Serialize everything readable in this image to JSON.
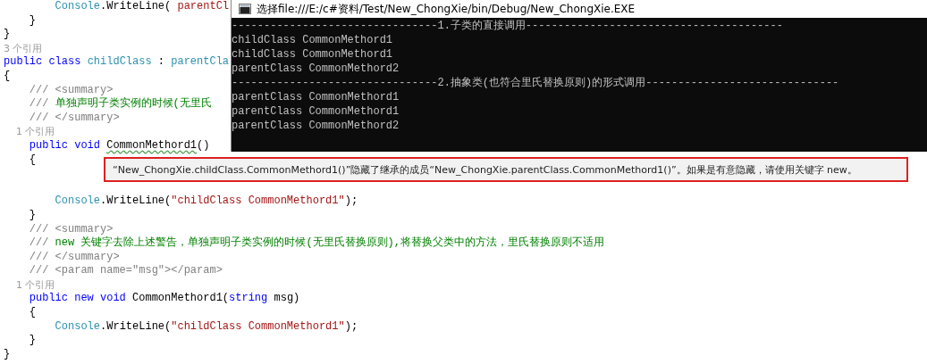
{
  "editor": {
    "lines": [
      {
        "kind": "code",
        "tokens": [
          {
            "text": "        Console",
            "kind": "type"
          },
          {
            "text": ".WriteLine( ",
            "kind": "plain"
          },
          {
            "text": "parentCl",
            "kind": "string"
          }
        ]
      },
      {
        "kind": "code",
        "tokens": [
          {
            "text": "    }",
            "kind": "plain"
          }
        ]
      },
      {
        "kind": "code",
        "tokens": [
          {
            "text": "}",
            "kind": "plain"
          }
        ]
      },
      {
        "kind": "lens",
        "tokens": [
          {
            "text": "3 个引用",
            "kind": "lens"
          }
        ]
      },
      {
        "kind": "code",
        "tokens": [
          {
            "text": "public class ",
            "kind": "keyword"
          },
          {
            "text": "childClass",
            "kind": "type"
          },
          {
            "text": " : ",
            "kind": "plain"
          },
          {
            "text": "parentCla",
            "kind": "type"
          }
        ]
      },
      {
        "kind": "code",
        "tokens": [
          {
            "text": "{",
            "kind": "plain"
          }
        ]
      },
      {
        "kind": "code",
        "tokens": [
          {
            "text": "    /// <summary>",
            "kind": "doc"
          }
        ]
      },
      {
        "kind": "code",
        "tokens": [
          {
            "text": "    /// ",
            "kind": "doc"
          },
          {
            "text": "单独声明子类实例的时候(无里氏",
            "kind": "comment"
          }
        ]
      },
      {
        "kind": "code",
        "tokens": [
          {
            "text": "    /// </summary>",
            "kind": "doc"
          }
        ]
      },
      {
        "kind": "lens",
        "tokens": [
          {
            "text": "    1 个引用",
            "kind": "lens"
          }
        ]
      },
      {
        "kind": "code",
        "tokens": [
          {
            "text": "    public void ",
            "kind": "keyword"
          },
          {
            "text": "CommonMethord1",
            "kind": "warn"
          },
          {
            "text": "()",
            "kind": "plain"
          }
        ]
      },
      {
        "kind": "code",
        "tokens": [
          {
            "text": "    {",
            "kind": "plain"
          }
        ]
      }
    ],
    "bottom_lines": [
      {
        "kind": "code",
        "tokens": [
          {
            "text": "        Console",
            "kind": "type"
          },
          {
            "text": ".WriteLine(",
            "kind": "plain"
          },
          {
            "text": "\"childClass CommonMethord1\"",
            "kind": "string"
          },
          {
            "text": ");",
            "kind": "plain"
          }
        ]
      },
      {
        "kind": "code",
        "tokens": [
          {
            "text": "    }",
            "kind": "plain"
          }
        ]
      },
      {
        "kind": "code",
        "tokens": [
          {
            "text": "    /// <summary>",
            "kind": "doc"
          }
        ]
      },
      {
        "kind": "code",
        "tokens": [
          {
            "text": "    /// ",
            "kind": "doc"
          },
          {
            "text": "new 关键字去除上述警告，单独声明子类实例的时候(无里氏替换原则),将替换父类中的方法，里氏替换原则不适用",
            "kind": "comment"
          }
        ]
      },
      {
        "kind": "code",
        "tokens": [
          {
            "text": "    /// </summary>",
            "kind": "doc"
          }
        ]
      },
      {
        "kind": "code",
        "tokens": [
          {
            "text": "    /// <param name=\"msg\"></param>",
            "kind": "doc"
          }
        ]
      },
      {
        "kind": "lens",
        "tokens": [
          {
            "text": "    1 个引用",
            "kind": "lens"
          }
        ]
      },
      {
        "kind": "code",
        "tokens": [
          {
            "text": "    public new void ",
            "kind": "keyword"
          },
          {
            "text": "CommonMethord1(",
            "kind": "plain"
          },
          {
            "text": "string",
            "kind": "keyword"
          },
          {
            "text": " msg)",
            "kind": "plain"
          }
        ]
      },
      {
        "kind": "code",
        "tokens": [
          {
            "text": "    {",
            "kind": "plain"
          }
        ]
      },
      {
        "kind": "code",
        "tokens": [
          {
            "text": "        Console",
            "kind": "type"
          },
          {
            "text": ".WriteLine(",
            "kind": "plain"
          },
          {
            "text": "\"childClass CommonMethord1\"",
            "kind": "string"
          },
          {
            "text": ");",
            "kind": "plain"
          }
        ]
      },
      {
        "kind": "code",
        "tokens": [
          {
            "text": "    }",
            "kind": "plain"
          }
        ]
      },
      {
        "kind": "code",
        "tokens": [
          {
            "text": "}",
            "kind": "plain"
          }
        ]
      }
    ]
  },
  "console": {
    "title": "选择file:///E:/c#资料/Test/New_ChongXie/bin/Debug/New_ChongXie.EXE",
    "lines": [
      "--------------------------------1.子类的直接调用----------------------------------------",
      "childClass CommonMethord1",
      "childClass CommonMethord1",
      "parentClass CommonMethord2",
      "--------------------------------2.抽象类(也符合里氏替换原则)的形式调用------------------------------",
      "parentClass CommonMethord1",
      "parentClass CommonMethord1",
      "parentClass CommonMethord2"
    ]
  },
  "tooltip": {
    "text": "“New_ChongXie.childClass.CommonMethord1()”隐藏了继承的成员“New_ChongXie.parentClass.CommonMethord1()”。如果是有意隐藏，请使用关键字 new。"
  }
}
